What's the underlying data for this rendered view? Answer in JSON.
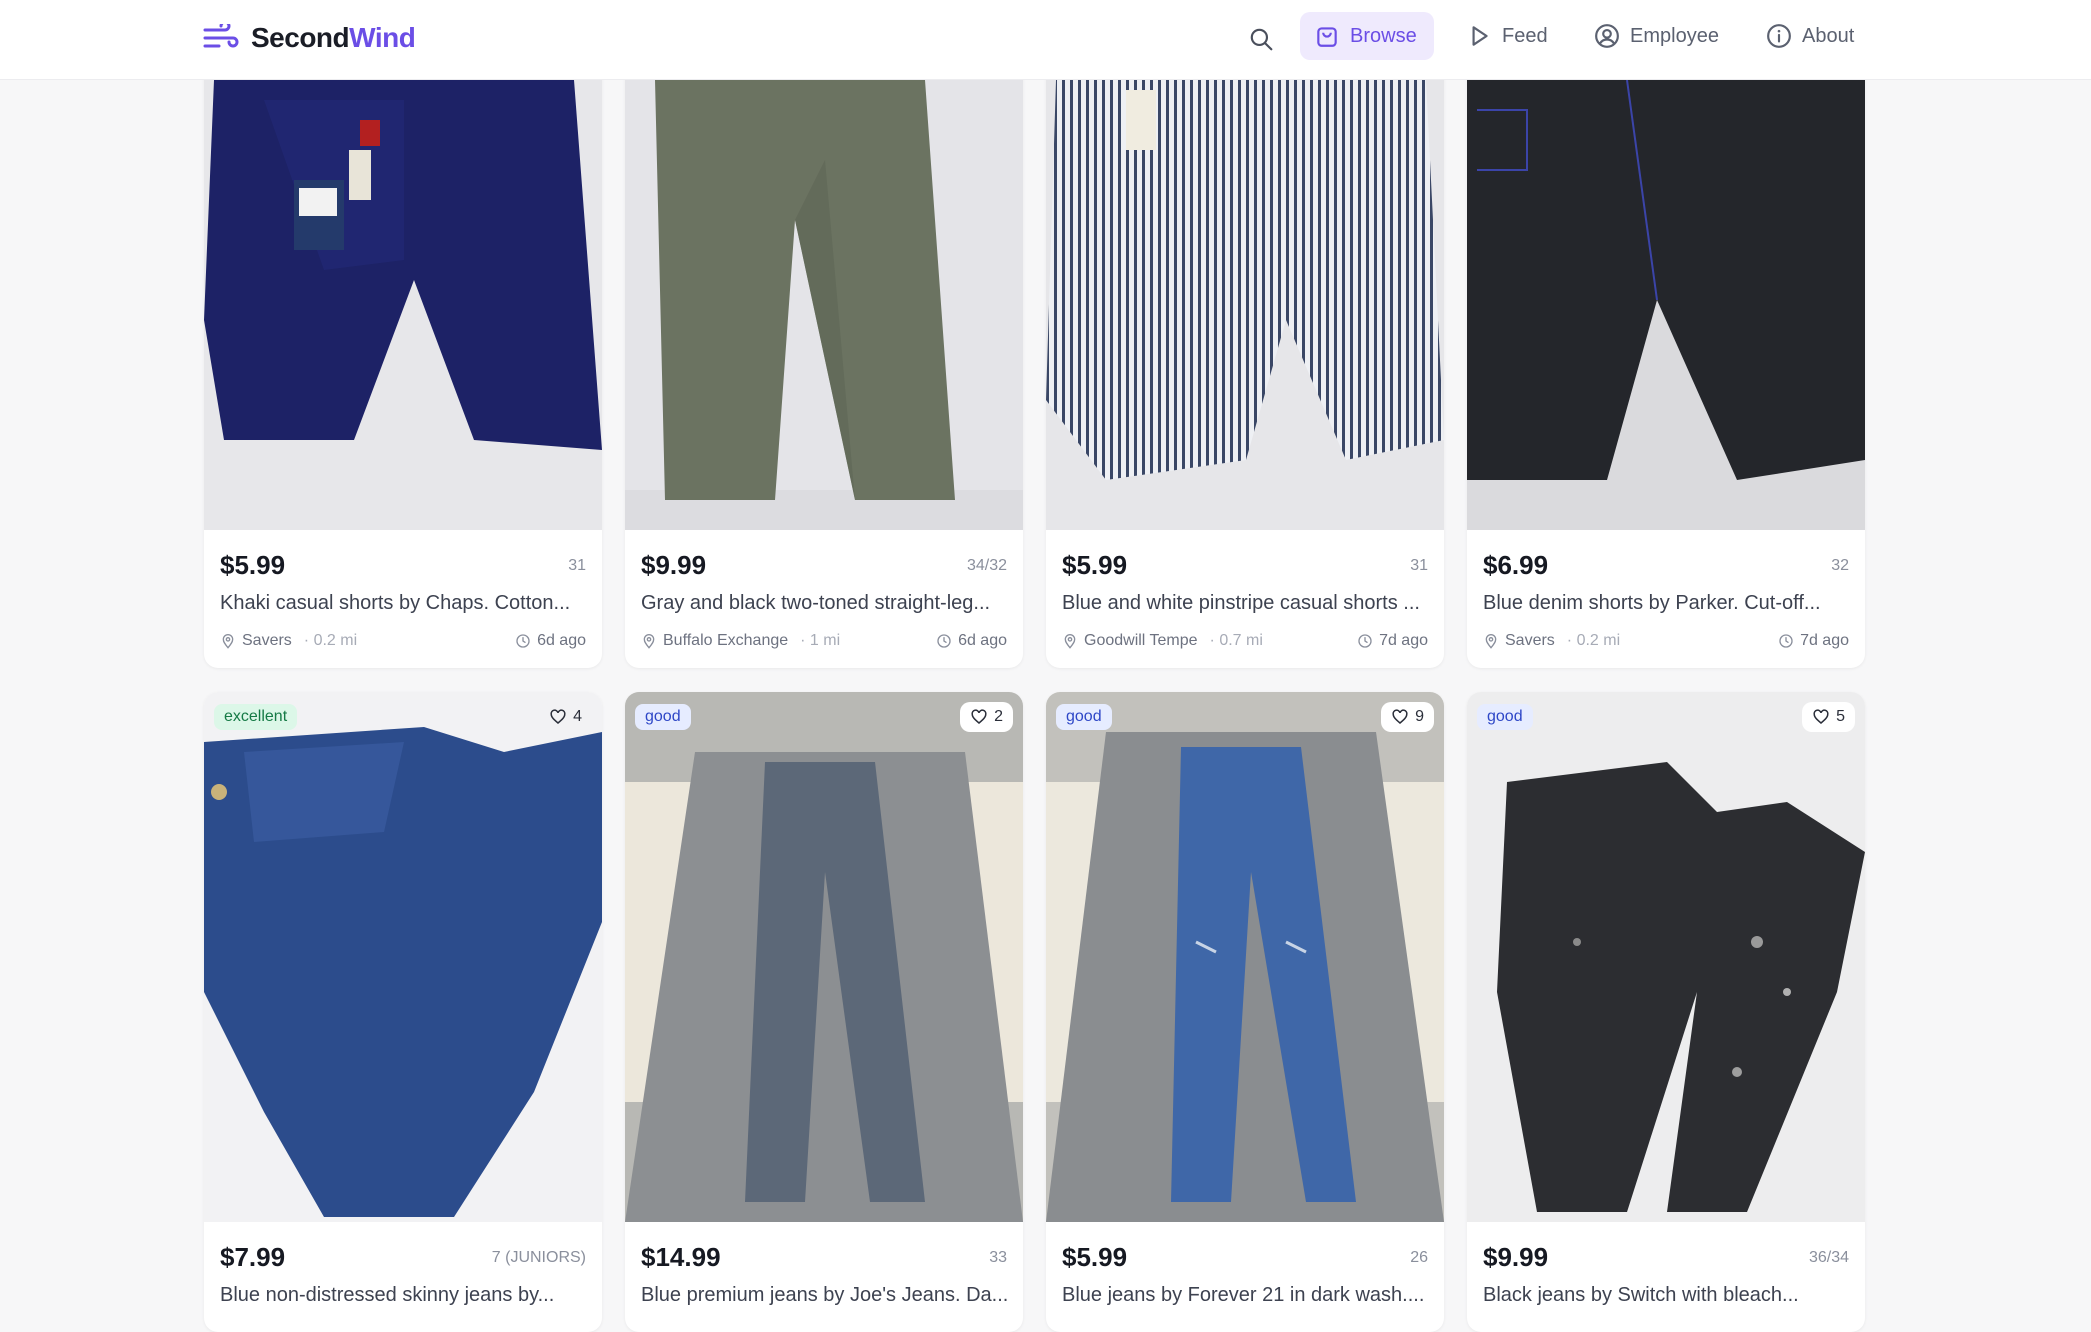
{
  "header": {
    "logo_part1": "Second",
    "logo_part2": "Wind",
    "brand_color": "#6b4ee6",
    "nav": [
      {
        "label": "Browse",
        "icon": "shopping-bag-icon",
        "active": true
      },
      {
        "label": "Feed",
        "icon": "play-icon",
        "active": false
      },
      {
        "label": "Employee",
        "icon": "user-circle-icon",
        "active": false
      },
      {
        "label": "About",
        "icon": "info-icon",
        "active": false
      }
    ],
    "search_icon": "search-icon"
  },
  "row1": [
    {
      "price": "$5.99",
      "size": "31",
      "title": "Khaki casual shorts by Chaps. Cotton...",
      "store": "Savers",
      "distance": "· 0.2 mi",
      "time": "6d ago"
    },
    {
      "price": "$9.99",
      "size": "34/32",
      "title": "Gray and black two-toned straight-leg...",
      "store": "Buffalo Exchange",
      "distance": "· 1 mi",
      "time": "6d ago"
    },
    {
      "price": "$5.99",
      "size": "31",
      "title": "Blue and white pinstripe casual shorts ...",
      "store": "Goodwill Tempe",
      "distance": "· 0.7 mi",
      "time": "7d ago"
    },
    {
      "price": "$6.99",
      "size": "32",
      "title": "Blue denim shorts by Parker. Cut-off...",
      "store": "Savers",
      "distance": "· 0.2 mi",
      "time": "7d ago"
    }
  ],
  "row2": [
    {
      "condition": "excellent",
      "likes": "4",
      "price": "$7.99",
      "size": "7 (JUNIORS)",
      "title": "Blue non-distressed skinny jeans by..."
    },
    {
      "condition": "good",
      "likes": "2",
      "price": "$14.99",
      "size": "33",
      "title": "Blue premium jeans by Joe's Jeans. Da..."
    },
    {
      "condition": "good",
      "likes": "9",
      "price": "$5.99",
      "size": "26",
      "title": "Blue jeans by Forever 21 in dark wash...."
    },
    {
      "condition": "good",
      "likes": "5",
      "price": "$9.99",
      "size": "36/34",
      "title": "Black jeans by Switch with bleach..."
    }
  ]
}
